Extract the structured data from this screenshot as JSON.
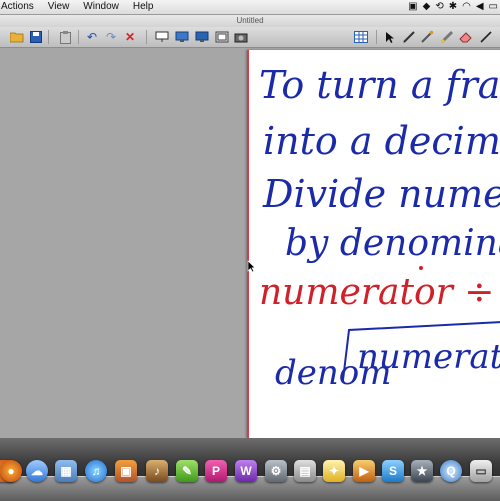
{
  "menubar": {
    "items": [
      "Actions",
      "View",
      "Window",
      "Help"
    ],
    "status_icons": [
      "screen-icon",
      "dropbox-icon",
      "time-machine-icon",
      "bluetooth-icon",
      "wifi-icon",
      "volume-icon",
      "battery-icon"
    ]
  },
  "window": {
    "title": "Untitled"
  },
  "toolbar": {
    "left_icons": [
      "open-folder-icon",
      "save-icon",
      "clipboard-icon",
      "undo-icon",
      "redo-icon",
      "delete-icon",
      "projector-icon",
      "display-icon",
      "monitor-icon",
      "screen-capture-icon",
      "camera-icon"
    ],
    "right_icons": [
      "table-icon",
      "select-arrow-icon",
      "pen-icon",
      "magic-pen-icon",
      "highlighter-icon",
      "eraser-icon",
      "line-icon"
    ]
  },
  "whiteboard": {
    "lines": [
      {
        "text": "To turn a fracti",
        "color": "#1a2aa8"
      },
      {
        "text": "into a decimal!",
        "color": "#1a2aa8"
      },
      {
        "text": "Divide numerator",
        "color": "#1a2aa8"
      },
      {
        "text": "by denominator",
        "color": "#1a2aa8"
      },
      {
        "text": "numerator ÷ denom",
        "color": "#d0202a"
      },
      {
        "text": "denom",
        "color": "#1a2aa8"
      },
      {
        "text": "numerator",
        "color": "#1a2aa8"
      }
    ]
  },
  "dock": {
    "icons": [
      "finder-icon",
      "firefox-icon",
      "ichat-icon",
      "photo-icon",
      "itunes-icon",
      "iphoto-icon",
      "guitar-icon",
      "smart-notebook-icon",
      "app-p-icon",
      "app-w-icon",
      "app-c-icon",
      "game-icon",
      "lightbulb-icon",
      "screenflow-icon",
      "app-s-icon",
      "imovie-icon",
      "quicktime-icon",
      "printer-icon"
    ]
  }
}
